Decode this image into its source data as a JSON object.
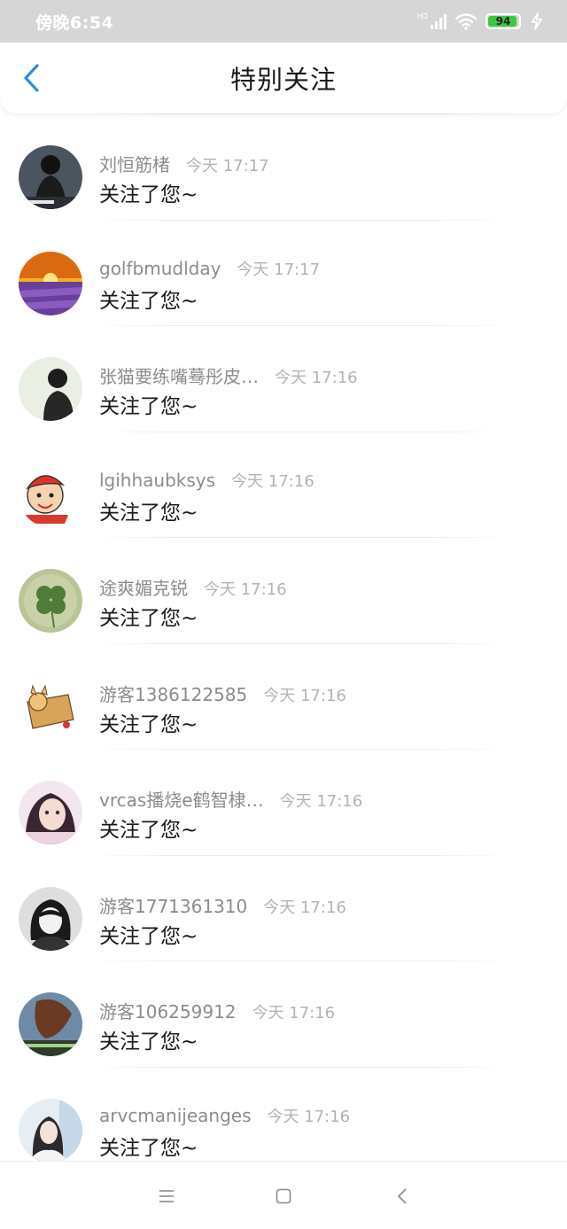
{
  "status_bar": {
    "time": "傍晚6:54",
    "network": "HD",
    "battery_level": 94,
    "battery_text": "94",
    "battery_color": "#3fc73f"
  },
  "header": {
    "title": "特别关注",
    "back_icon": "chevron-left-icon",
    "accent_color": "#2b8ee8"
  },
  "notifications": [
    {
      "name": "刘恒筋楮",
      "time": "今天 17:17",
      "text": "关注了您~"
    },
    {
      "name": "golfbmudlday",
      "time": "今天 17:17",
      "text": "关注了您~"
    },
    {
      "name": "张猫要练嘴蓦彤皮…",
      "time": "今天 17:16",
      "text": "关注了您~"
    },
    {
      "name": "lgihhaubksys",
      "time": "今天 17:16",
      "text": "关注了您~"
    },
    {
      "name": "途爽媚克锐",
      "time": "今天 17:16",
      "text": "关注了您~"
    },
    {
      "name": "游客1386122585",
      "time": "今天 17:16",
      "text": "关注了您~"
    },
    {
      "name": "vrcas播烧e鹤智棣…",
      "time": "今天 17:16",
      "text": "关注了您~"
    },
    {
      "name": "游客1771361310",
      "time": "今天 17:16",
      "text": "关注了您~"
    },
    {
      "name": "游客106259912",
      "time": "今天 17:16",
      "text": "关注了您~"
    },
    {
      "name": "arvcmanijeanges",
      "time": "今天 17:16",
      "text": "关注了您~"
    }
  ],
  "nav_bar": {
    "menu_icon": "menu-icon",
    "home_icon": "home-square-icon",
    "back_icon": "back-triangle-icon"
  }
}
